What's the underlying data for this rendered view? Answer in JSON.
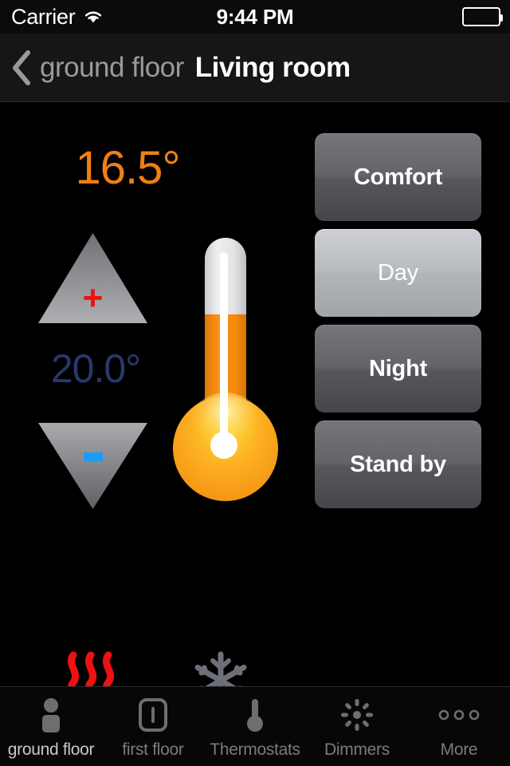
{
  "status_bar": {
    "carrier": "Carrier",
    "wifi_icon": "wifi-icon",
    "time": "9:44 PM",
    "battery_icon": "battery-full-icon"
  },
  "nav_bar": {
    "back_icon": "chevron-left-icon",
    "back_label": "ground floor",
    "title": "Living room"
  },
  "thermostat": {
    "current_temperature": "16.5°",
    "target_temperature": "20.0°",
    "increase_icon": "plus-icon",
    "decrease_icon": "minus-icon",
    "increase_button_name": "temperature-up",
    "decrease_button_name": "temperature-down",
    "thermometer_icon": "thermometer-icon",
    "thermometer_fill_percent": 68,
    "heating_icon": "heat-waves-icon",
    "heating_active": true,
    "cooling_icon": "snowflake-icon",
    "cooling_active": false
  },
  "modes": {
    "selected": "Day",
    "buttons": [
      {
        "label": "Comfort",
        "selected": false
      },
      {
        "label": "Day",
        "selected": true
      },
      {
        "label": "Night",
        "selected": false
      },
      {
        "label": "Stand by",
        "selected": false
      }
    ]
  },
  "tab_bar": {
    "tabs": [
      {
        "label": "ground floor",
        "icon": "person-icon",
        "active": true
      },
      {
        "label": "first floor",
        "icon": "light-switch-icon",
        "active": false
      },
      {
        "label": "Thermostats",
        "icon": "thermometer-icon",
        "active": false
      },
      {
        "label": "Dimmers",
        "icon": "brightness-icon",
        "active": false
      },
      {
        "label": "More",
        "icon": "ellipsis-icon",
        "active": false
      }
    ]
  },
  "colors": {
    "current_temp": "#f08013",
    "target_temp": "#27386c",
    "heat_red": "#ee1111",
    "cool_gray": "#6d7079",
    "plus_red": "#ee1111",
    "minus_blue": "#1c9bf5",
    "background": "#000000"
  }
}
